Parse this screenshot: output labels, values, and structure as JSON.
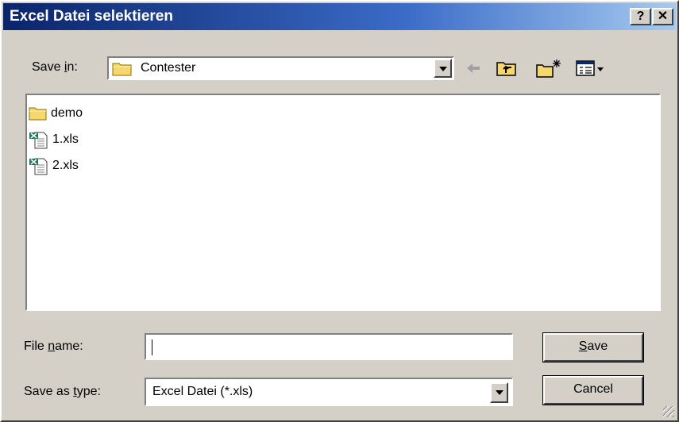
{
  "window": {
    "title": "Excel Datei selektieren",
    "help_label": "?",
    "close_label": "✕"
  },
  "save_in": {
    "label_pre": "Save ",
    "label_u": "i",
    "label_post": "n:",
    "value": "Contester",
    "icon": "folder-icon"
  },
  "toolbar": {
    "back_icon": "back-arrow-icon",
    "up_icon": "up-folder-icon",
    "new_folder_icon": "new-folder-icon",
    "views_icon": "views-menu-icon"
  },
  "files": [
    {
      "name": "demo",
      "icon": "folder-icon"
    },
    {
      "name": "1.xls",
      "icon": "excel-file-icon"
    },
    {
      "name": "2.xls",
      "icon": "excel-file-icon"
    }
  ],
  "file_name": {
    "label_pre": "File ",
    "label_u": "n",
    "label_post": "ame:",
    "value": ""
  },
  "save_as_type": {
    "label_pre": "Save as ",
    "label_u": "t",
    "label_post": "ype:",
    "value": "Excel Datei (*.xls)"
  },
  "buttons": {
    "save_u": "S",
    "save_rest": "ave",
    "cancel": "Cancel"
  },
  "colors": {
    "title_start": "#0a246a",
    "title_end": "#a6caf0",
    "face": "#d4d0c8",
    "folder_yellow": "#f5d76e"
  }
}
